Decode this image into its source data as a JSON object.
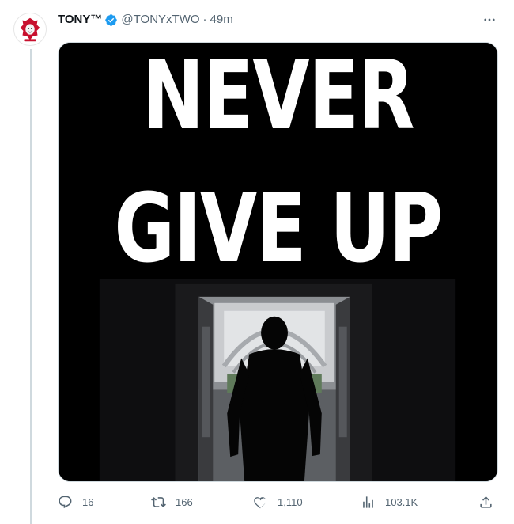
{
  "tweet": {
    "display_name": "TONY™",
    "handle": "@TONYxTWO",
    "separator": "·",
    "time": "49m",
    "media": {
      "line1": "NEVER",
      "line2": "GIVE UP"
    },
    "stats": {
      "replies": "16",
      "retweets": "166",
      "likes": "1,110",
      "views": "103.1K"
    }
  },
  "icons": {
    "more": "more-icon",
    "verified": "verified-badge-icon",
    "reply": "reply-icon",
    "retweet": "retweet-icon",
    "like": "like-icon",
    "views": "views-icon",
    "share": "share-icon"
  },
  "colors": {
    "verified": "#1d9bf0",
    "muted": "#536471",
    "text": "#0f1419",
    "avatar_accent": "#c8102e"
  }
}
